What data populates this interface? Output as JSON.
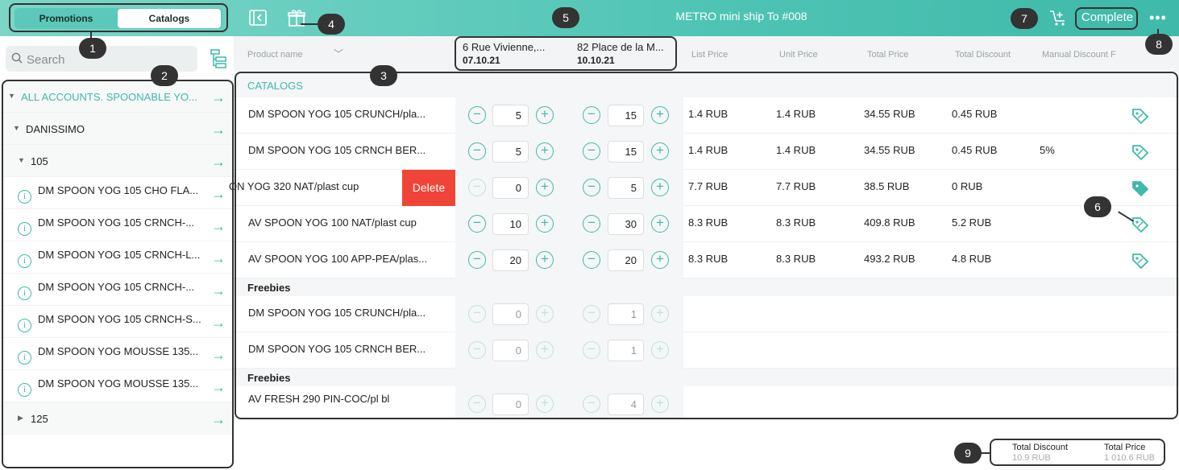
{
  "header": {
    "tabs": [
      {
        "label": "Promotions",
        "selected": false
      },
      {
        "label": "Catalogs",
        "selected": true
      }
    ],
    "title": "METRO mini ship To #008",
    "complete_label": "Complete",
    "more_label": "•••",
    "accent_color": "#3fb9a9"
  },
  "sidebar": {
    "search_placeholder": "Search",
    "items": [
      {
        "label": "ALL ACCOUNTS. SPOONABLE YO...",
        "level": 0,
        "expanded": true,
        "highlight": true
      },
      {
        "label": "DANISSIMO",
        "level": 1,
        "expanded": true
      },
      {
        "label": "105",
        "level": 2,
        "expanded": true
      },
      {
        "label": "DM SPOON YOG 105 CHO FLA...",
        "info": true
      },
      {
        "label": "DM SPOON YOG 105 CRNCH-...",
        "info": true
      },
      {
        "label": "DM SPOON YOG 105 CRNCH-L...",
        "info": true
      },
      {
        "label": "DM SPOON YOG 105 CRNCH-...",
        "info": true
      },
      {
        "label": "DM SPOON YOG 105 CRNCH-S...",
        "info": true
      },
      {
        "label": "DM SPOON YOG MOUSSE 135...",
        "info": true
      },
      {
        "label": "DM SPOON YOG MOUSSE 135...",
        "info": true
      },
      {
        "label": "125",
        "level": 2,
        "expanded": false
      }
    ]
  },
  "columns": {
    "product_name": "Product name",
    "store1_address": "6 Rue Vivienne,...",
    "store1_date": "07.10.21",
    "store2_address": "82 Place de la M...",
    "store2_date": "10.10.21",
    "list_price": "List Price",
    "unit_price": "Unit Price",
    "total_price": "Total Price",
    "total_discount": "Total Discount",
    "manual_discount": "Manual Discount F"
  },
  "catalogs": {
    "title": "CATALOGS",
    "products": [
      {
        "name": "DM SPOON YOG 105 CRUNCH/pla...",
        "q1": "5",
        "q2": "15",
        "list_price": "1.4 RUB",
        "unit_price": "1.4 RUB",
        "total_price": "34.55 RUB",
        "total_discount": "0.45 RUB",
        "manual_discount": ""
      },
      {
        "name": "DM SPOON YOG 105 CRNCH BER...",
        "q1": "5",
        "q2": "15",
        "list_price": "1.4 RUB",
        "unit_price": "1.4 RUB",
        "total_price": "34.55 RUB",
        "total_discount": "0.45 RUB",
        "manual_discount": "5%"
      },
      {
        "name": "ON YOG 320 NAT/plast cup",
        "q1": "0",
        "q2": "5",
        "list_price": "7.7 RUB",
        "unit_price": "7.7 RUB",
        "total_price": "38.5 RUB",
        "total_discount": "0 RUB",
        "manual_discount": "",
        "delete_label": "Delete"
      },
      {
        "name": "AV SPOON YOG 100 NAT/plast cup",
        "q1": "10",
        "q2": "30",
        "list_price": "8.3 RUB",
        "unit_price": "8.3 RUB",
        "total_price": "409.8 RUB",
        "total_discount": "5.2 RUB",
        "manual_discount": ""
      },
      {
        "name": "AV SPOON YOG 100 APP-PEA/plas...",
        "q1": "20",
        "q2": "20",
        "list_price": "8.3 RUB",
        "unit_price": "8.3 RUB",
        "total_price": "493.2 RUB",
        "total_discount": "4.8 RUB",
        "manual_discount": ""
      }
    ]
  },
  "freebies1": {
    "title": "Freebies",
    "products": [
      {
        "name": "DM SPOON YOG 105 CRUNCH/pla...",
        "q1": "0",
        "q2": "1"
      },
      {
        "name": "DM SPOON YOG 105 CRNCH BER...",
        "q1": "0",
        "q2": "1"
      }
    ]
  },
  "freebies2": {
    "title": "Freebies",
    "products": [
      {
        "name": "AV FRESH 290 PIN-COC/pl bl",
        "q1": "0",
        "q2": "4"
      }
    ]
  },
  "totals": {
    "discount_label": "Total Discount",
    "discount_value": "10.9 RUB",
    "price_label": "Total Price",
    "price_value": "1 010.6 RUB"
  },
  "annotations": [
    "1",
    "2",
    "3",
    "4",
    "5",
    "6",
    "7",
    "8",
    "9"
  ]
}
